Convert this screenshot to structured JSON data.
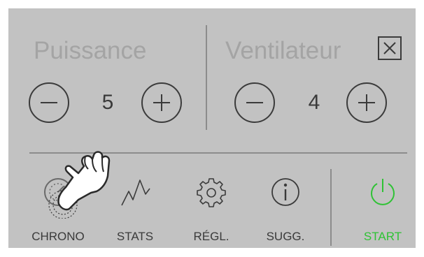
{
  "power": {
    "label": "Puissance",
    "value": "5"
  },
  "fan": {
    "label": "Ventilateur",
    "value": "4"
  },
  "nav": [
    {
      "label": "CHRONO",
      "icon": "chrono-icon"
    },
    {
      "label": "STATS",
      "icon": "stats-icon"
    },
    {
      "label": "RÉGL.",
      "icon": "gear-icon"
    },
    {
      "label": "SUGG.",
      "icon": "info-icon"
    }
  ],
  "start": {
    "label": "START",
    "icon": "power-icon"
  },
  "colors": {
    "panel": "#c2c2c2",
    "inactive_label": "#a4a4a4",
    "stroke": "#3b3b3b",
    "accent_green": "#2ec234"
  }
}
